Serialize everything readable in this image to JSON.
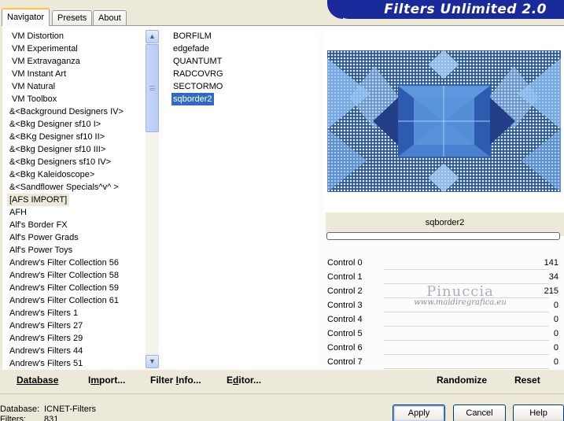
{
  "tabs": [
    {
      "label": "Navigator",
      "active": true
    },
    {
      "label": "Presets",
      "active": false
    },
    {
      "label": "About",
      "active": false
    }
  ],
  "header": {
    "title": "Filters Unlimited 2.0"
  },
  "categories": [
    "VM Distortion",
    "VM Experimental",
    "VM Extravaganza",
    "VM Instant Art",
    "VM Natural",
    "VM Toolbox",
    "&<Background Designers IV>",
    "&<Bkg Designer sf10 I>",
    "&<BKg Designer sf10 II>",
    "&<Bkg Designer sf10 III>",
    "&<Bkg Designers sf10 IV>",
    "&<Bkg Kaleidoscope>",
    "&<Sandflower Specials^v^ >",
    "[AFS IMPORT]",
    "AFH",
    "Alf's Border FX",
    "Alf's Power Grads",
    "Alf's Power Toys",
    "Andrew's Filter Collection 56",
    "Andrew's Filter Collection 58",
    "Andrew's Filter Collection 59",
    "Andrew's Filter Collection 61",
    "Andrew's Filters 1",
    "Andrew's Filters 27",
    "Andrew's Filters 29",
    "Andrew's Filters 44",
    "Andrew's Filters 51"
  ],
  "current_category": "[AFS IMPORT]",
  "filters": [
    "BORFILM",
    "edgefade",
    "QUANTUMT",
    "RADCOVRG",
    "SECTORMO",
    "sqborder2"
  ],
  "selected_filter": "sqborder2",
  "preview": {
    "filter_name": "sqborder2"
  },
  "controls": [
    {
      "label": "Control 0",
      "value": "141"
    },
    {
      "label": "Control 1",
      "value": "34"
    },
    {
      "label": "Control 2",
      "value": "215"
    },
    {
      "label": "Control 3",
      "value": "0"
    },
    {
      "label": "Control 4",
      "value": "0"
    },
    {
      "label": "Control 5",
      "value": "0"
    },
    {
      "label": "Control 6",
      "value": "0"
    },
    {
      "label": "Control 7",
      "value": "0"
    }
  ],
  "watermark": {
    "name": "Pinuccia",
    "url": "www.maidiregrafica.eu"
  },
  "actions": {
    "database": "Database",
    "import_first": "I",
    "import_u": "m",
    "import_rest": "port...",
    "filter_info_first": "Filter ",
    "filter_info_u": "I",
    "filter_info_rest": "nfo...",
    "editor_first": "E",
    "editor_u": "d",
    "editor_rest": "itor...",
    "randomize": "Randomize",
    "reset": "Reset"
  },
  "status": {
    "database_label": "Database:",
    "database_value": "ICNET-Filters",
    "filters_label": "Filters:",
    "filters_value": "831"
  },
  "buttons": {
    "apply": "Apply",
    "cancel": "Cancel",
    "help": "Help"
  },
  "colors": {
    "accent_selection": "#316ac5",
    "banner": "#1a2a9a",
    "window_bg": "#ece9d8"
  },
  "icons": {
    "scroll_up": "▲",
    "scroll_down": "▼"
  }
}
